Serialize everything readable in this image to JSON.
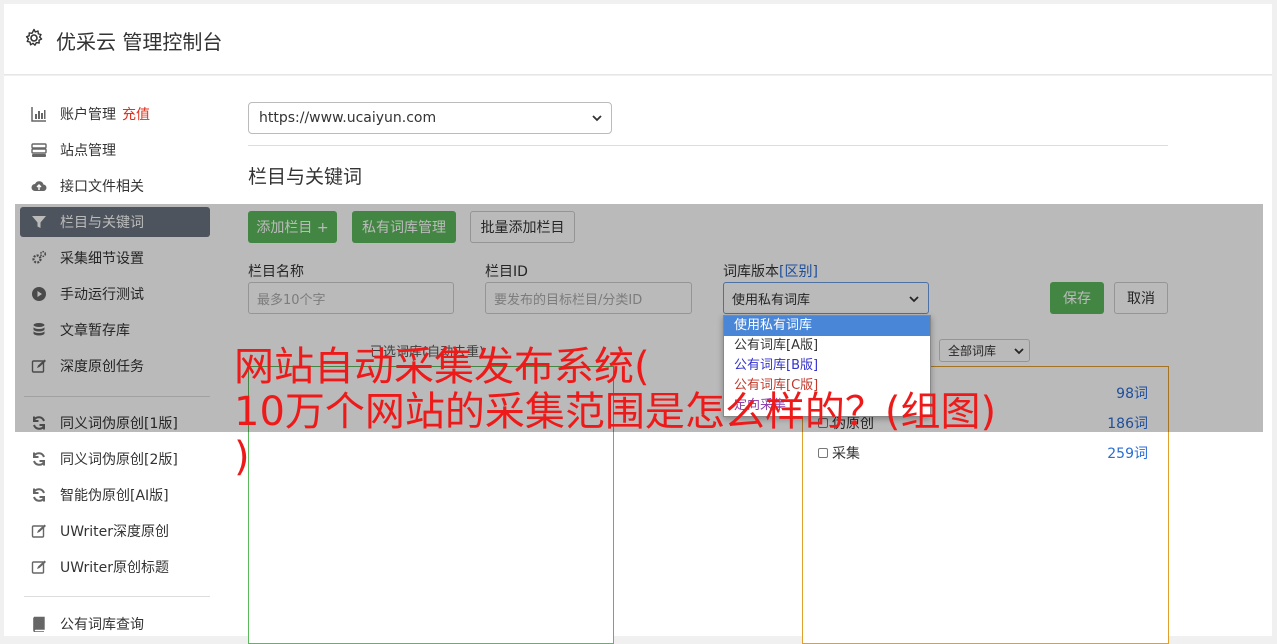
{
  "header": {
    "title": "优采云 管理控制台",
    "icon": "gear-icon"
  },
  "sidebar": {
    "recharge": "充值",
    "items": [
      {
        "label": "账户管理",
        "icon": "bar-chart-icon"
      },
      {
        "label": "站点管理",
        "icon": "server-icon"
      },
      {
        "label": "接口文件相关",
        "icon": "cloud-upload-icon"
      },
      {
        "label": "栏目与关键词",
        "icon": "filter-icon",
        "active": true
      },
      {
        "label": "采集细节设置",
        "icon": "cogs-icon"
      },
      {
        "label": "手动运行测试",
        "icon": "play-circle-icon"
      },
      {
        "label": "文章暂存库",
        "icon": "database-icon"
      },
      {
        "label": "深度原创任务",
        "icon": "edit-icon"
      },
      {
        "label": "同义词伪原创[1版]",
        "icon": "refresh-icon"
      },
      {
        "label": "同义词伪原创[2版]",
        "icon": "refresh-icon"
      },
      {
        "label": "智能伪原创[AI版]",
        "icon": "refresh-icon"
      },
      {
        "label": "UWriter深度原创",
        "icon": "edit-icon"
      },
      {
        "label": "UWriter原创标题",
        "icon": "edit-icon"
      },
      {
        "label": "公有词库查询",
        "icon": "book-icon"
      }
    ]
  },
  "main": {
    "site_select": "https://www.ucaiyun.com",
    "section_title": "栏目与关键词",
    "buttons": {
      "add_column": "添加栏目 +",
      "private_lib": "私有词库管理",
      "batch_add": "批量添加栏目",
      "save": "保存",
      "cancel": "取消"
    },
    "form": {
      "name_label": "栏目名称",
      "name_placeholder": "最多10个字",
      "id_label": "栏目ID",
      "id_placeholder": "要发布的目标栏目/分类ID",
      "lib_label": "词库版本",
      "lib_label_link": "[区别]",
      "lib_selected": "使用私有词库"
    },
    "dropdown_options": [
      "使用私有词库",
      "公有词库[A版]",
      "公有词库[B版]",
      "公有词库[C版]",
      "定向采集"
    ],
    "selected_lib_caption": "已选词库(自动去重)",
    "lib_filter": "全部词库",
    "keywords": [
      {
        "name": "",
        "count": "98词"
      },
      {
        "name": "伪原创",
        "count": "186词"
      },
      {
        "name": "采集",
        "count": "259词"
      }
    ]
  },
  "colors": {
    "green": "#5cb85c",
    "active": "#6c7380",
    "link": "#2a6dd6",
    "banner": "#ee1a1a"
  },
  "banner": {
    "line1": "网站自动采集发布系统(",
    "line2": "10万个网站的采集范围是怎么样的？(组图)",
    "line3": ")"
  }
}
